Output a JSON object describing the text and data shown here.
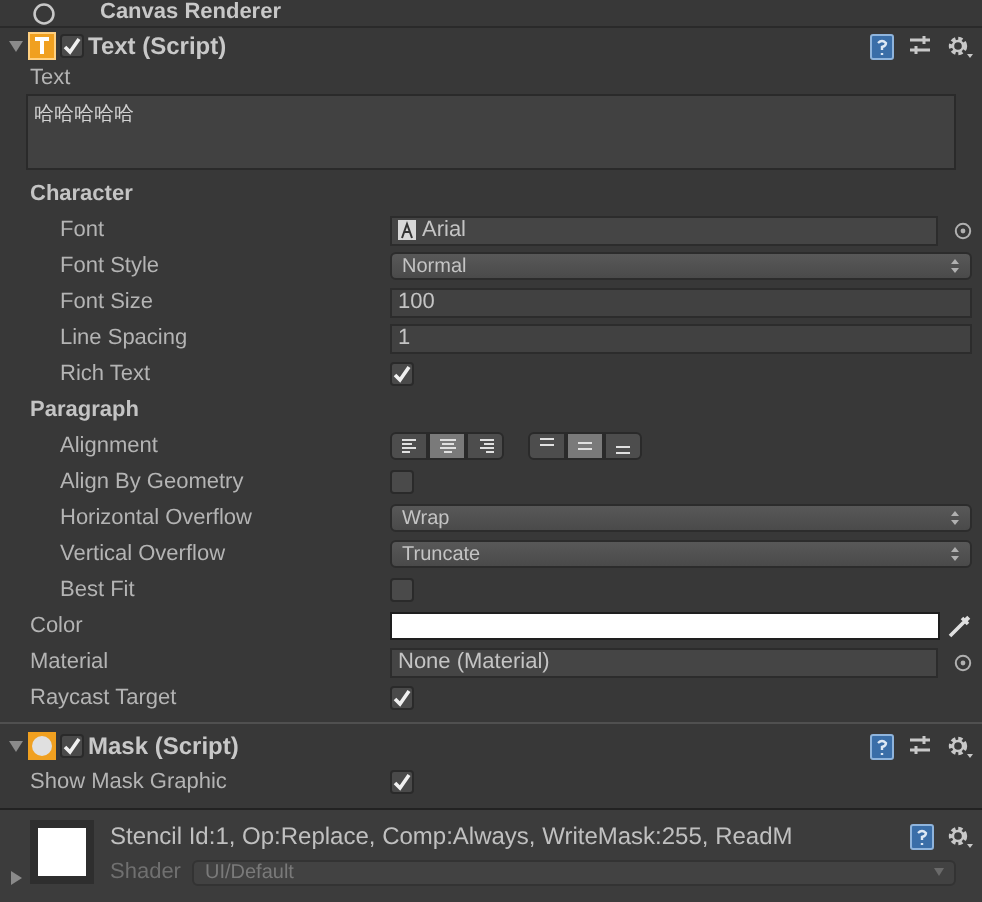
{
  "partial_header": {
    "title": "Canvas Renderer"
  },
  "text_component": {
    "title": "Text (Script)",
    "enabled": true,
    "expanded": true,
    "text_label": "Text",
    "text_value": "哈哈哈哈哈",
    "sections": [
      {
        "kind": "section",
        "label": "Character",
        "children": [
          {
            "kind": "object",
            "label": "Font",
            "value": "Arial"
          },
          {
            "kind": "dropdown",
            "label": "Font Style",
            "value": "Normal"
          },
          {
            "kind": "number",
            "label": "Font Size",
            "value": "100"
          },
          {
            "kind": "number",
            "label": "Line Spacing",
            "value": "1"
          },
          {
            "kind": "checkbox",
            "label": "Rich Text",
            "checked": true
          }
        ]
      },
      {
        "kind": "section",
        "label": "Paragraph",
        "children": [
          {
            "kind": "alignment",
            "label": "Alignment",
            "horizontal": [
              {
                "selected": false
              },
              {
                "selected": true
              },
              {
                "selected": false
              }
            ],
            "vertical": [
              {
                "selected": false
              },
              {
                "selected": true
              },
              {
                "selected": false
              }
            ]
          },
          {
            "kind": "checkbox",
            "label": "Align By Geometry",
            "checked": false
          },
          {
            "kind": "dropdown",
            "label": "Horizontal Overflow",
            "value": "Wrap"
          },
          {
            "kind": "dropdown",
            "label": "Vertical Overflow",
            "value": "Truncate"
          },
          {
            "kind": "checkbox",
            "label": "Best Fit",
            "checked": false
          }
        ]
      },
      {
        "kind": "color",
        "label": "Color",
        "color": "#ffffff"
      },
      {
        "kind": "object_none",
        "label": "Material",
        "value": "None (Material)"
      },
      {
        "kind": "checkbox",
        "label": "Raycast Target",
        "checked": true
      }
    ]
  },
  "mask_component": {
    "title": "Mask (Script)",
    "enabled": true,
    "expanded": true,
    "properties": [
      {
        "kind": "checkbox",
        "label": "Show Mask Graphic",
        "checked": true
      }
    ]
  },
  "material": {
    "name": "Stencil Id:1, Op:Replace, Comp:Always, WriteMask:255, ReadM",
    "shader_label": "Shader",
    "shader": "UI/Default",
    "expanded": false
  }
}
